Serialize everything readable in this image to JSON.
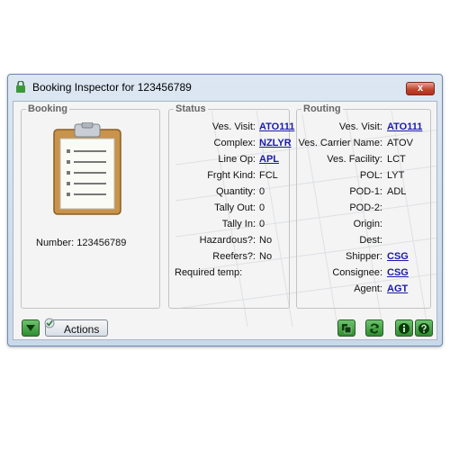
{
  "window": {
    "title": "Booking Inspector for 123456789",
    "close_label": "x"
  },
  "booking": {
    "title": "Booking",
    "number_label": "Number:",
    "number_value": "123456789",
    "icon": "clipboard-icon"
  },
  "status": {
    "title": "Status",
    "rows": [
      {
        "label": "Ves. Visit:",
        "value": "ATO111",
        "link": true
      },
      {
        "label": "Complex:",
        "value": "NZLYR",
        "link": true
      },
      {
        "label": "Line Op:",
        "value": "APL",
        "link": true
      },
      {
        "label": "Frght Kind:",
        "value": "FCL",
        "link": false
      },
      {
        "label": "Quantity:",
        "value": "0",
        "link": false
      },
      {
        "label": "Tally Out:",
        "value": "0",
        "link": false
      },
      {
        "label": "Tally In:",
        "value": "0",
        "link": false
      },
      {
        "label": "Hazardous?:",
        "value": "No",
        "link": false
      },
      {
        "label": "Reefers?:",
        "value": "No",
        "link": false
      }
    ],
    "required_temp_label": "Required temp:"
  },
  "routing": {
    "title": "Routing",
    "rows": [
      {
        "label": "Ves. Visit:",
        "value": "ATO111",
        "link": true
      },
      {
        "label": "Ves. Carrier Name:",
        "value": "ATOV",
        "link": false
      },
      {
        "label": "Ves. Facility:",
        "value": "LCT",
        "link": false
      },
      {
        "label": "POL:",
        "value": "LYT",
        "link": false
      },
      {
        "label": "POD-1:",
        "value": "ADL",
        "link": false
      },
      {
        "label": "POD-2:",
        "value": "",
        "link": false
      },
      {
        "label": "Origin:",
        "value": "",
        "link": false
      },
      {
        "label": "Dest:",
        "value": "",
        "link": false
      },
      {
        "label": "Shipper:",
        "value": "CSG",
        "link": true
      },
      {
        "label": "Consignee:",
        "value": "CSG",
        "link": true
      },
      {
        "label": "Agent:",
        "value": "AGT",
        "link": true
      }
    ]
  },
  "toolbar": {
    "actions_label": "Actions",
    "buttons": [
      "expand-down-icon",
      "actions-check-icon",
      "copy-icon",
      "refresh-icon",
      "info-icon",
      "help-icon"
    ]
  },
  "colors": {
    "link": "#1a1aa8",
    "green_button": "#2f8d2f",
    "close_red": "#c0402a"
  }
}
